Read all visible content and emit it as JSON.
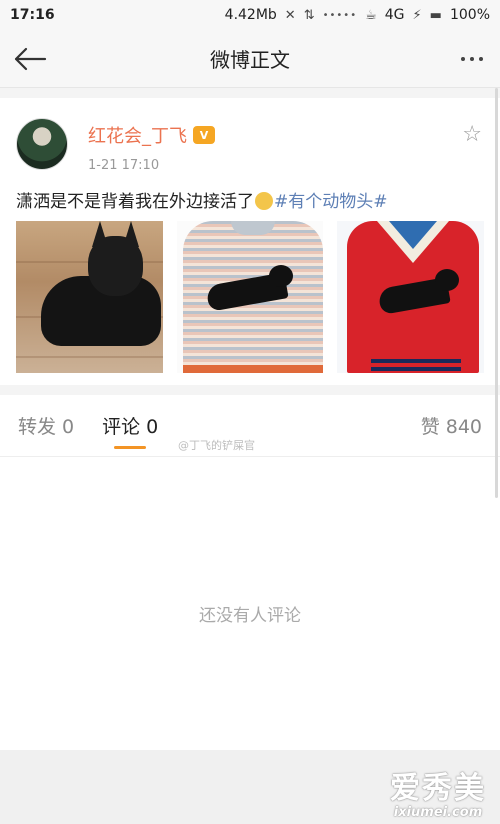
{
  "status_bar": {
    "time": "17:16",
    "data_rate": "4.42Mb",
    "signal_dots": "•••••",
    "network": "4G",
    "battery": "100%"
  },
  "nav": {
    "back_icon": "arrow-left-icon",
    "title": "微博正文",
    "more_icon": "more-dots-icon"
  },
  "post": {
    "author": "红花会_丁飞",
    "badge": "V",
    "time": "1-21 17:10",
    "text_before": "潇洒是不是背着我在外边接活了",
    "topic": "#有个动物头#",
    "images": [
      "dog-photo",
      "striped-sweater-photo",
      "red-sweater-photo"
    ]
  },
  "tabs": {
    "repost": "转发 0",
    "comment": "评论 0",
    "like": "赞 840",
    "watermark": "@丁飞的铲屎官"
  },
  "comments": {
    "empty_text": "还没有人评论"
  },
  "watermark": {
    "cn": "爱秀美",
    "url": "ixiumei.com"
  },
  "colors": {
    "accent_orange": "#f39425",
    "author_name": "#eb7350",
    "topic_link": "#5d7fb5"
  }
}
